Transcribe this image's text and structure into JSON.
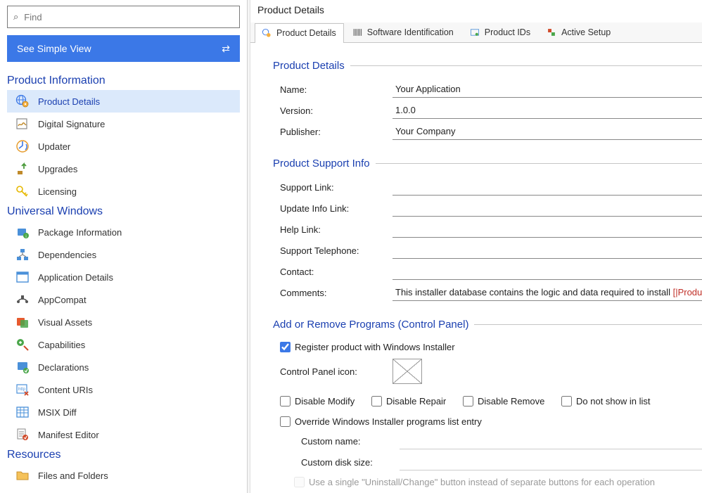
{
  "sidebar": {
    "find_placeholder": "Find",
    "simple_view_label": "See Simple View",
    "categories": [
      {
        "title": "Product Information",
        "items": [
          {
            "id": "product-details",
            "label": "Product Details",
            "selected": true
          },
          {
            "id": "digital-signature",
            "label": "Digital Signature"
          },
          {
            "id": "updater",
            "label": "Updater"
          },
          {
            "id": "upgrades",
            "label": "Upgrades"
          },
          {
            "id": "licensing",
            "label": "Licensing"
          }
        ]
      },
      {
        "title": "Universal Windows",
        "items": [
          {
            "id": "package-info",
            "label": "Package Information"
          },
          {
            "id": "dependencies",
            "label": "Dependencies"
          },
          {
            "id": "app-details",
            "label": "Application Details"
          },
          {
            "id": "appcompat",
            "label": "AppCompat"
          },
          {
            "id": "visual-assets",
            "label": "Visual Assets"
          },
          {
            "id": "capabilities",
            "label": "Capabilities"
          },
          {
            "id": "declarations",
            "label": "Declarations"
          },
          {
            "id": "content-uris",
            "label": "Content URIs"
          },
          {
            "id": "msix-diff",
            "label": "MSIX Diff"
          },
          {
            "id": "manifest-editor",
            "label": "Manifest Editor"
          }
        ]
      },
      {
        "title": "Resources",
        "items": [
          {
            "id": "files-folders",
            "label": "Files and Folders"
          }
        ]
      }
    ]
  },
  "main": {
    "header_title": "Product Details",
    "tabs": [
      {
        "label": "Product Details",
        "active": true
      },
      {
        "label": "Software Identification"
      },
      {
        "label": "Product IDs"
      },
      {
        "label": "Active Setup"
      }
    ],
    "groups": {
      "product_details": {
        "legend": "Product Details",
        "name_label": "Name:",
        "name_value": "Your Application",
        "version_label": "Version:",
        "version_value": "1.0.0",
        "publisher_label": "Publisher:",
        "publisher_value": "Your Company"
      },
      "support_info": {
        "legend": "Product Support Info",
        "support_link_label": "Support Link:",
        "support_link_value": "",
        "update_info_label": "Update Info Link:",
        "update_info_value": "",
        "help_link_label": "Help Link:",
        "help_link_value": "",
        "telephone_label": "Support Telephone:",
        "telephone_value": "",
        "contact_label": "Contact:",
        "contact_value": "",
        "comments_label": "Comments:",
        "comments_prefix": "This installer database contains the logic and data required to install ",
        "comments_macro": "[|ProductName]",
        "comments_suffix": "."
      },
      "arp": {
        "legend": "Add or Remove Programs (Control Panel)",
        "register_label": "Register product with Windows Installer",
        "control_panel_icon_label": "Control Panel icon:",
        "disable_modify": "Disable Modify",
        "disable_repair": "Disable Repair",
        "disable_remove": "Disable Remove",
        "do_not_show": "Do not show in list",
        "override_label": "Override Windows Installer programs list entry",
        "custom_name_label": "Custom name:",
        "custom_disk_label": "Custom disk size:",
        "single_button_label": "Use a single \"Uninstall/Change\" button instead of separate buttons for each operation"
      }
    }
  }
}
